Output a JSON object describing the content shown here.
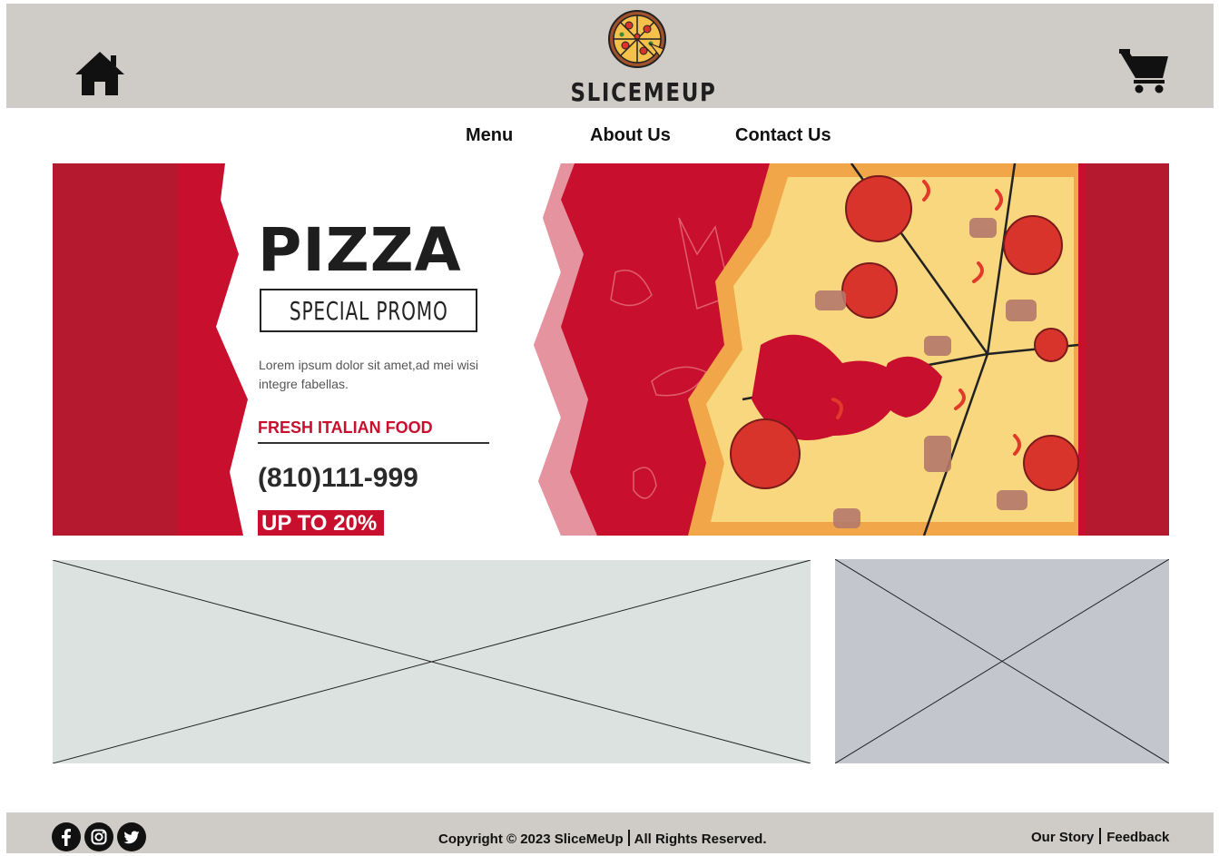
{
  "header": {
    "brand": "SLICEMEUP",
    "home_icon": "home-icon",
    "cart_icon": "shopping-cart-icon",
    "logo_icon": "pizza-logo-icon"
  },
  "nav": {
    "items": [
      {
        "label": "Menu"
      },
      {
        "label": "About Us"
      },
      {
        "label": "Contact Us"
      }
    ]
  },
  "banner": {
    "title": "PIZZA",
    "subtitle": "SPECIAL PROMO",
    "description": "Lorem ipsum dolor sit amet,ad mei wisi integre fabellas.",
    "tagline": "FRESH ITALIAN FOOD",
    "phone": "(810)111-999",
    "discount": "UP TO 20%",
    "colors": {
      "brand_red": "#c8102e",
      "dark_red": "#b5192f"
    }
  },
  "content": {
    "placeholders": [
      "image-placeholder",
      "image-placeholder"
    ]
  },
  "footer": {
    "copyright_main": "Copyright © 2023 SliceMeUp",
    "copyright_rights": "All Rights Reserved.",
    "links": [
      {
        "label": "Our Story"
      },
      {
        "label": "Feedback"
      }
    ],
    "social": [
      "facebook-icon",
      "instagram-icon",
      "twitter-icon"
    ]
  }
}
